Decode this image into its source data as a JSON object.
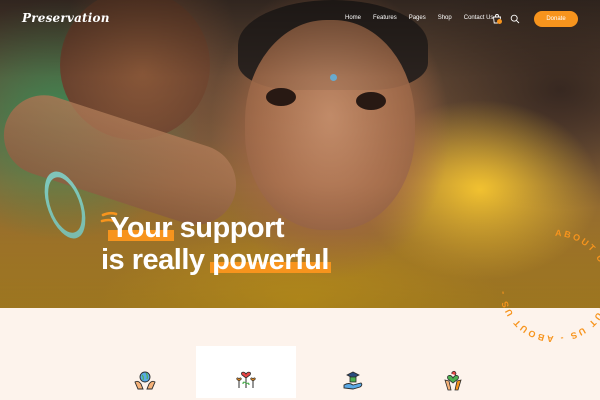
{
  "brand": {
    "logo_text": "Preservation",
    "accent_color": "#f7941d"
  },
  "nav": {
    "items": [
      {
        "label": "Home"
      },
      {
        "label": "Features"
      },
      {
        "label": "Pages"
      },
      {
        "label": "Shop"
      },
      {
        "label": "Contact Us"
      }
    ],
    "cart_icon": "cart-icon",
    "search_icon": "search-icon",
    "donate_label": "Donate"
  },
  "hero": {
    "line1_highlight": "Your",
    "line1_rest": " support",
    "line2_lead": "is really ",
    "line2_highlight": "powerful"
  },
  "about_badge": {
    "text": "ABOUT US - ABOUT US - ABOUT US - "
  },
  "features": {
    "items": [
      {
        "icon": "globe-hands-icon"
      },
      {
        "icon": "hearts-plants-icon",
        "active": true
      },
      {
        "icon": "graduation-hand-icon"
      },
      {
        "icon": "heart-hands-icon"
      }
    ]
  }
}
